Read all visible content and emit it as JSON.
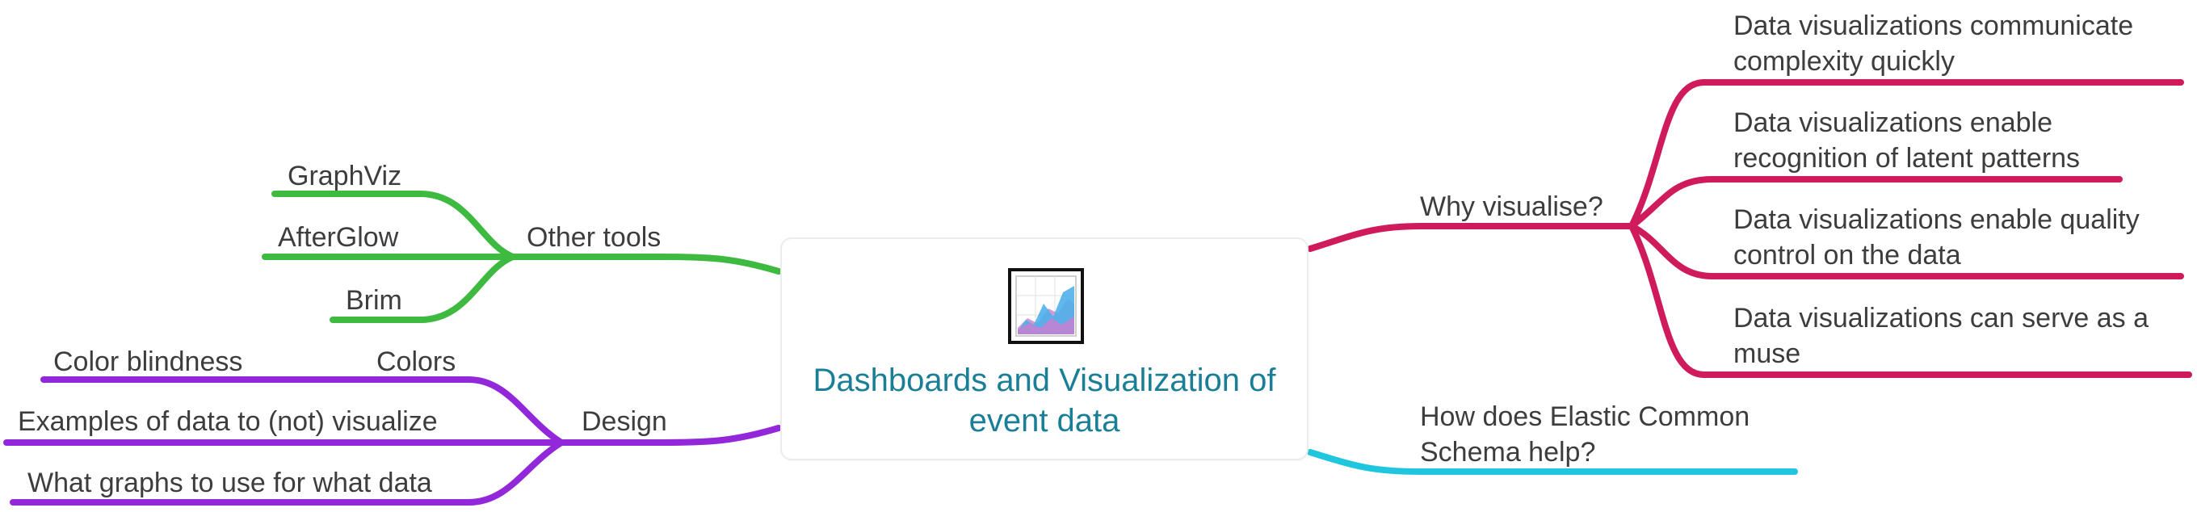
{
  "central": {
    "title": "Dashboards and Visualization of event data",
    "icon": "area-chart-icon"
  },
  "colors": {
    "why": "#cf1b5b",
    "ecs": "#1fc6dd",
    "tools": "#3dba3f",
    "design": "#9228d9",
    "title": "#1a7f96",
    "text": "#3d3d3d"
  },
  "branches": {
    "why": {
      "label": "Why visualise?",
      "children": [
        "Data visualizations communicate complexity quickly",
        "Data visualizations enable recognition of latent patterns",
        "Data visualizations enable quality control on the data",
        "Data visualizations can serve as a muse"
      ]
    },
    "ecs": {
      "label": "How does Elastic Common Schema help?"
    },
    "tools": {
      "label": "Other tools",
      "children": [
        "GraphViz",
        "AfterGlow",
        "Brim"
      ]
    },
    "design": {
      "label": "Design",
      "colors": {
        "label": "Colors",
        "children": [
          "Color blindness"
        ]
      },
      "children": [
        "Examples of data to (not) visualize",
        "What graphs to use for what data"
      ]
    }
  }
}
